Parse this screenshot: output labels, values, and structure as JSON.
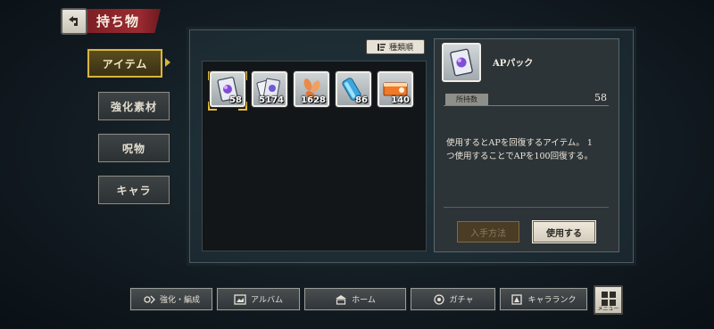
{
  "header": {
    "title": "持ち物"
  },
  "tabs": [
    {
      "label": "アイテム",
      "active": true
    },
    {
      "label": "強化素材",
      "active": false
    },
    {
      "label": "呪物",
      "active": false
    },
    {
      "label": "キャラ",
      "active": false
    }
  ],
  "sort": {
    "label": "種類順"
  },
  "items": [
    {
      "count": "58",
      "icon": "ap-pack-icon",
      "selected": true
    },
    {
      "count": "5174",
      "icon": "cards-icon",
      "selected": false
    },
    {
      "count": "1628",
      "icon": "petals-icon",
      "selected": false
    },
    {
      "count": "86",
      "icon": "tube-icon",
      "selected": false
    },
    {
      "count": "140",
      "icon": "ticket-icon",
      "selected": false
    }
  ],
  "detail": {
    "name": "APパック",
    "owned_label": "所持数",
    "owned_value": "58",
    "description_line1": "使用するとAPを回復するアイテム。 1",
    "description_line2": "つ使用することでAPを100回復する。",
    "acquire_label": "入手方法",
    "use_label": "使用する"
  },
  "nav": [
    {
      "label": "強化・編成",
      "icon": "enhance-icon"
    },
    {
      "label": "アルバム",
      "icon": "album-icon"
    },
    {
      "label": "ホーム",
      "icon": "home-icon"
    },
    {
      "label": "ガチャ",
      "icon": "gacha-icon"
    },
    {
      "label": "キャラランク",
      "icon": "rank-icon"
    }
  ],
  "menu": {
    "label": "メニュー"
  },
  "colors": {
    "accent": "#d9b53c",
    "banner": "#9c2b31"
  }
}
